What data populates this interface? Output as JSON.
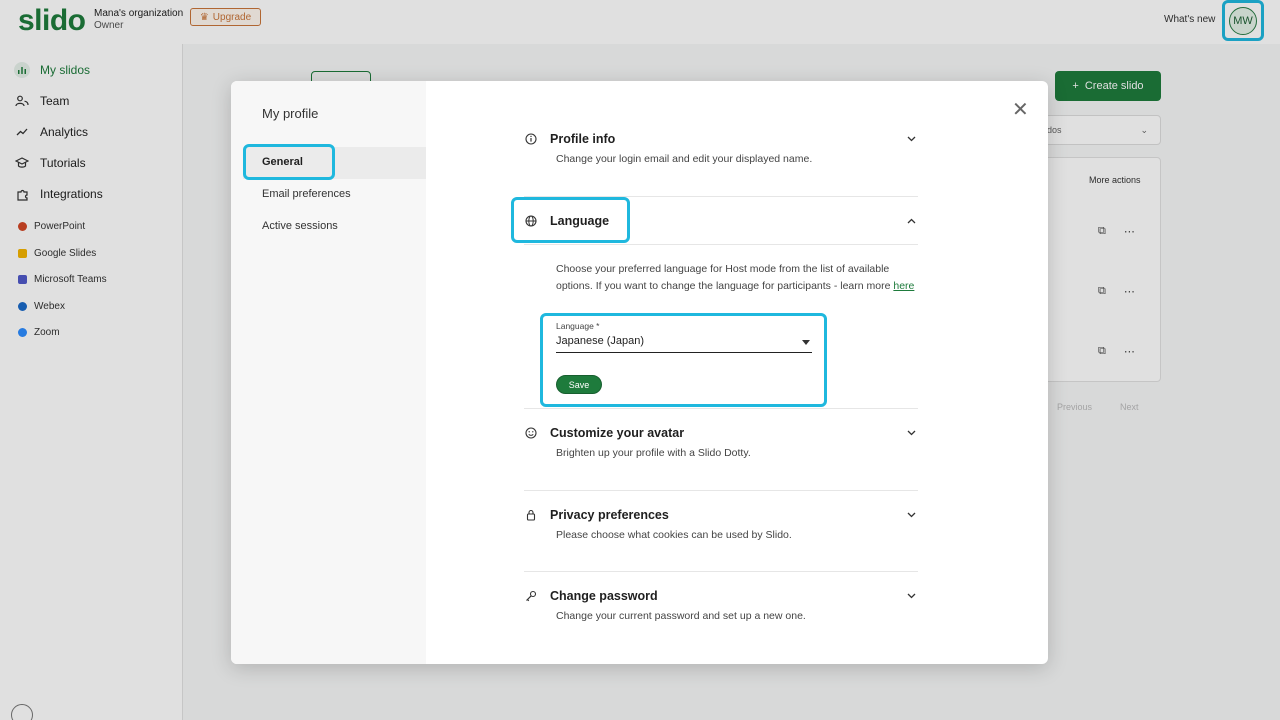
{
  "app": {
    "logo": "slido",
    "org_name": "Mana's organization",
    "org_role": "Owner",
    "upgrade_label": "Upgrade",
    "whats_new": "What's new",
    "avatar_initials": "MW"
  },
  "sidebar": {
    "items": [
      {
        "label": "My slidos",
        "icon": "bar-chart-icon"
      },
      {
        "label": "Team",
        "icon": "people-icon"
      },
      {
        "label": "Analytics",
        "icon": "trend-icon"
      },
      {
        "label": "Tutorials",
        "icon": "graduation-cap-icon"
      },
      {
        "label": "Integrations",
        "icon": "puzzle-icon"
      }
    ],
    "integrations": [
      {
        "label": "PowerPoint",
        "color": "#d24726"
      },
      {
        "label": "Google Slides",
        "color": "#f4b400"
      },
      {
        "label": "Microsoft Teams",
        "color": "#5059c9"
      },
      {
        "label": "Webex",
        "color": "#1b6ac9"
      },
      {
        "label": "Zoom",
        "color": "#2d8cff"
      }
    ]
  },
  "main": {
    "create_label": "Create slido",
    "filter_label": "lidos",
    "more_actions": "More actions",
    "pager_prev": "Previous",
    "pager_next": "Next"
  },
  "modal": {
    "title": "My profile",
    "nav": [
      "General",
      "Email preferences",
      "Active sessions"
    ],
    "sections": {
      "profile": {
        "title": "Profile info",
        "desc": "Change your login email and edit your displayed name."
      },
      "language": {
        "title": "Language",
        "desc": "Choose your preferred language for Host mode from the list of available options. If you want to change the language for participants - learn more ",
        "link": "here",
        "field_label": "Language *",
        "field_value": "Japanese (Japan)",
        "save_label": "Save"
      },
      "avatar": {
        "title": "Customize your avatar",
        "desc": "Brighten up your profile with a Slido Dotty."
      },
      "privacy": {
        "title": "Privacy preferences",
        "desc": "Please choose what cookies can be used by Slido."
      },
      "password": {
        "title": "Change password",
        "desc": "Change your current password and set up a new one."
      }
    }
  },
  "colors": {
    "brand": "#1e7b3c",
    "highlight": "#1fb8de"
  }
}
